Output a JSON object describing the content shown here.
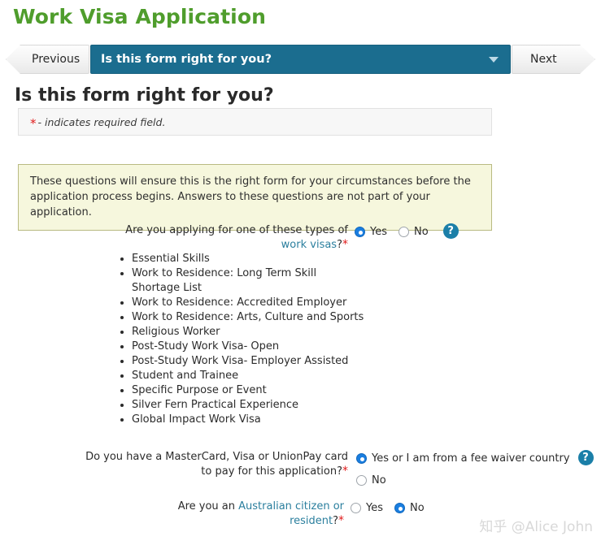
{
  "page_title": "Work Visa Application",
  "nav": {
    "previous_label": "Previous",
    "next_label": "Next",
    "current_step": "Is this form right for you?",
    "caret_icon": "chevron-down-icon"
  },
  "section": {
    "heading": "Is this form right for you?",
    "required_star": "*",
    "required_note": "- indicates required field.",
    "info_text": "These questions will ensure this is the right form for your circumstances before the application process begins. Answers to these questions are not part of your application."
  },
  "questions": [
    {
      "id": "work-visa-types",
      "label_before_link": "Are you applying for one of these types of ",
      "label_link": "work visas",
      "label_after_link": "?",
      "required": "*",
      "help_icon": "question-mark-icon",
      "options": [
        {
          "label": "Yes",
          "selected": true
        },
        {
          "label": "No",
          "selected": false
        }
      ],
      "list": [
        "Essential Skills",
        "Work to Residence: Long Term Skill Shortage List",
        "Work to Residence: Accredited Employer",
        "Work to Residence: Arts, Culture and Sports",
        "Religious Worker",
        "Post-Study Work Visa- Open",
        "Post-Study Work Visa- Employer Assisted",
        "Student and Trainee",
        "Specific Purpose or Event",
        "Silver Fern Practical Experience",
        "Global Impact Work Visa"
      ]
    },
    {
      "id": "payment-card",
      "label": "Do you have a MasterCard, Visa or UnionPay card to pay for this application?",
      "required": "*",
      "help_icon": "question-mark-icon",
      "options": [
        {
          "label": "Yes or I am from a fee waiver country",
          "selected": true
        },
        {
          "label": "No",
          "selected": false
        }
      ]
    },
    {
      "id": "australian-citizen",
      "label_before_link": "Are you an ",
      "label_link": "Australian citizen or resident",
      "label_after_link": "?",
      "required": "*",
      "options": [
        {
          "label": "Yes",
          "selected": false
        },
        {
          "label": "No",
          "selected": true
        }
      ]
    }
  ],
  "watermark": "知乎 @Alice John",
  "colors": {
    "title_green": "#4f9d2c",
    "nav_teal": "#1b6d8f",
    "link_teal": "#2b7f9e",
    "required_red": "#e01b1b",
    "radio_blue": "#1a7ee0",
    "help_blue": "#1b7fa8",
    "info_bg": "#f6f7dd",
    "info_border": "#b9ba82"
  }
}
